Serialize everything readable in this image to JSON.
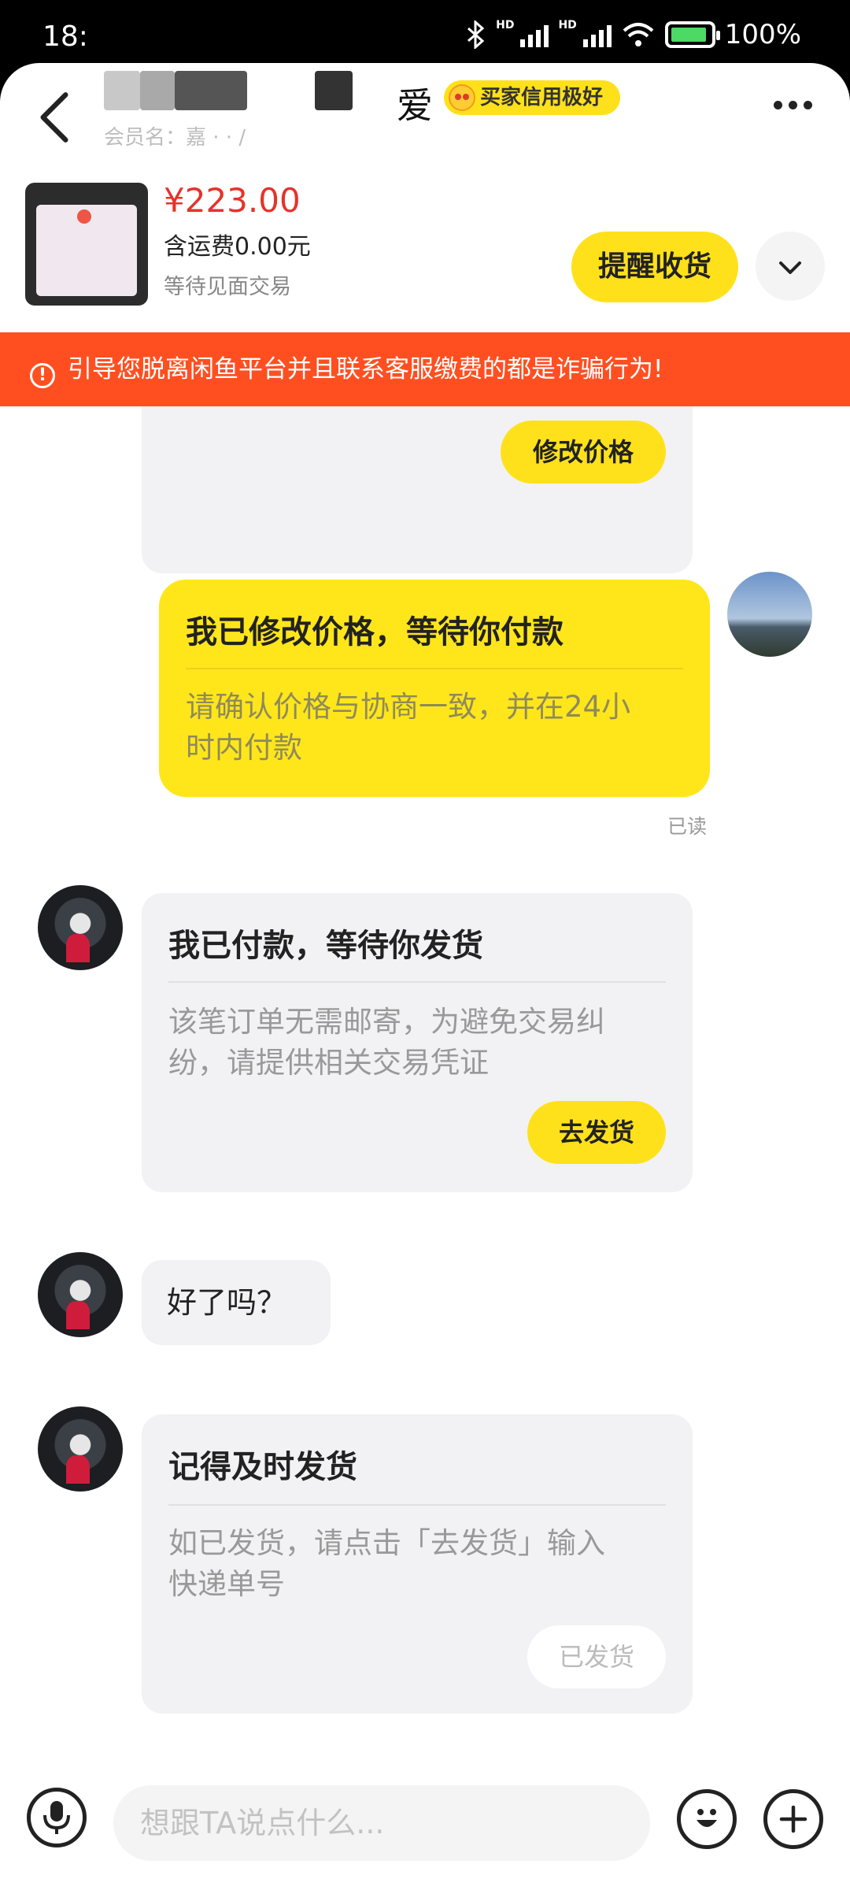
{
  "status_bar": {
    "time": "18:",
    "battery": "100%"
  },
  "header": {
    "title_tail": "爱",
    "credit_badge": "买家信用极好",
    "member_label": "会员名：嘉 ·  ·  /",
    "icons": [
      "back-arrow-icon",
      "more-dots-icon"
    ]
  },
  "product": {
    "price": "¥223.00",
    "shipping": "含运费0.00元",
    "status": "等待见面交易",
    "remind_label": "提醒收货"
  },
  "warning": {
    "text": "引导您脱离闲鱼平台并且联系客服缴费的都是诈骗行为!"
  },
  "messages": {
    "modify_price_button": "修改价格",
    "seller_card": {
      "title": "我已修改价格，等待你付款",
      "desc_line1": "请确认价格与协商一致，并在24小",
      "desc_line2": "时内付款",
      "read": "已读"
    },
    "paid_card": {
      "title": "我已付款，等待你发货",
      "desc_line1": "该笔订单无需邮寄，为避免交易纠",
      "desc_line2": "纷，请提供相关交易凭证",
      "button": "去发货"
    },
    "text_message": "好了吗？",
    "ship_reminder_card": {
      "title": "记得及时发货",
      "desc_line1": "如已发货，请点击「去发货」输入",
      "desc_line2": "快递单号",
      "button": "已发货"
    }
  },
  "input_bar": {
    "placeholder": "想跟TA说点什么..."
  }
}
